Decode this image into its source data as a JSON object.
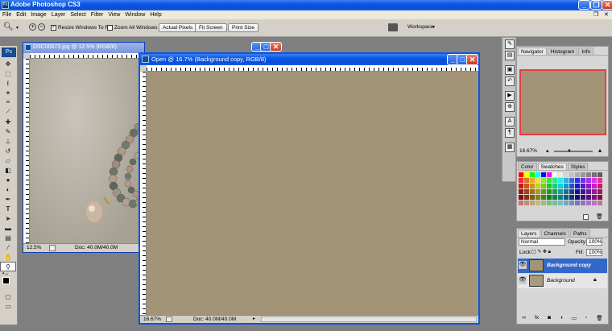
{
  "app": {
    "title": "Adobe Photoshop CS3",
    "icon_label": "Ps"
  },
  "menu": [
    "File",
    "Edit",
    "Image",
    "Layer",
    "Select",
    "Filter",
    "View",
    "Window",
    "Help"
  ],
  "options": {
    "resize_windows": "Resize Windows To Fit",
    "zoom_all": "Zoom All Windows",
    "actual_pixels": "Actual Pixels",
    "fit_screen": "Fit Screen",
    "print_size": "Print Size",
    "workspace": "Workspace"
  },
  "doc1": {
    "title": "DSC00673.jpg @ 12.5% (RGB/8)",
    "zoom": "12.5%",
    "doc_size": "Doc: 40.0M/40.0M"
  },
  "doc2": {
    "title": "Open @ 16.7% (Background copy, RGB/8)",
    "zoom": "16.67%",
    "doc_size": "Doc: 40.0M/40.0M",
    "canvas_color": "#a39478"
  },
  "navigator": {
    "tabs": [
      "Navigator",
      "Histogram",
      "Info"
    ],
    "zoom": "16.67%"
  },
  "color_panel": {
    "tabs": [
      "Color",
      "Swatches",
      "Styles"
    ]
  },
  "layers_panel": {
    "tabs": [
      "Layers",
      "Channels",
      "Paths"
    ],
    "blend_mode": "Normal",
    "opacity_label": "Opacity:",
    "opacity": "100%",
    "lock_label": "Lock:",
    "fill_label": "Fill:",
    "fill": "100%",
    "layers": [
      {
        "name": "Background copy",
        "selected": true
      },
      {
        "name": "Background",
        "selected": false
      }
    ]
  }
}
